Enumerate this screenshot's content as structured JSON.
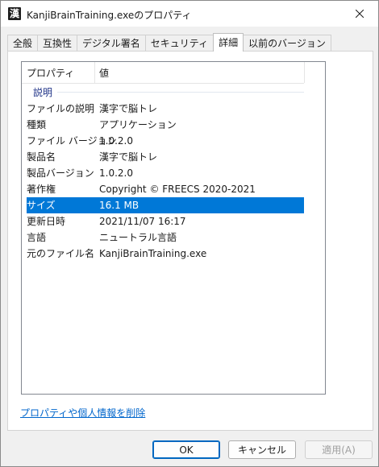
{
  "window": {
    "title": "KanjiBrainTraining.exeのプロパティ",
    "app_icon_glyph": "漢"
  },
  "tabs": [
    {
      "label": "全般"
    },
    {
      "label": "互換性"
    },
    {
      "label": "デジタル署名"
    },
    {
      "label": "セキュリティ"
    },
    {
      "label": "詳細",
      "active": true
    },
    {
      "label": "以前のバージョン"
    }
  ],
  "list": {
    "header": {
      "property": "プロパティ",
      "value": "値"
    },
    "group_label": "説明",
    "rows": [
      {
        "key": "ファイルの説明",
        "value": "漢字で脳トレ"
      },
      {
        "key": "種類",
        "value": "アプリケーション"
      },
      {
        "key": "ファイル バージョン",
        "value": "1.0.2.0"
      },
      {
        "key": "製品名",
        "value": "漢字で脳トレ"
      },
      {
        "key": "製品バージョン",
        "value": "1.0.2.0"
      },
      {
        "key": "著作権",
        "value": "Copyright © FREECS 2020-2021"
      },
      {
        "key": "サイズ",
        "value": "16.1 MB",
        "selected": true
      },
      {
        "key": "更新日時",
        "value": "2021/11/07 16:17"
      },
      {
        "key": "言語",
        "value": "ニュートラル言語"
      },
      {
        "key": "元のファイル名",
        "value": "KanjiBrainTraining.exe"
      }
    ]
  },
  "remove_link": "プロパティや個人情報を削除",
  "buttons": {
    "ok": "OK",
    "cancel": "キャンセル",
    "apply": "適用(A)"
  },
  "colors": {
    "selection": "#0078d7",
    "group_text": "#1e3287",
    "link": "#0066cc"
  }
}
